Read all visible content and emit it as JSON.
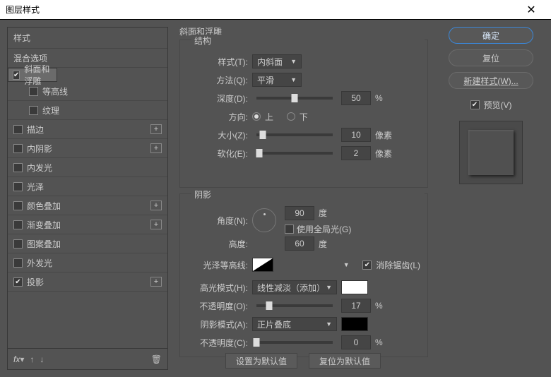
{
  "title": "图层样式",
  "sidebar": {
    "header": "样式",
    "blend": "混合选项",
    "items": [
      {
        "label": "斜面和浮雕",
        "checked": true,
        "selected": true,
        "plus": false
      },
      {
        "label": "等高线",
        "checked": false,
        "indent": true
      },
      {
        "label": "纹理",
        "checked": false,
        "indent": true
      },
      {
        "label": "描边",
        "checked": false,
        "plus": true
      },
      {
        "label": "内阴影",
        "checked": false,
        "plus": true
      },
      {
        "label": "内发光",
        "checked": false
      },
      {
        "label": "光泽",
        "checked": false
      },
      {
        "label": "颜色叠加",
        "checked": false,
        "plus": true
      },
      {
        "label": "渐变叠加",
        "checked": false,
        "plus": true
      },
      {
        "label": "图案叠加",
        "checked": false
      },
      {
        "label": "外发光",
        "checked": false
      },
      {
        "label": "投影",
        "checked": true,
        "plus": true
      }
    ],
    "foot_fx": "fx"
  },
  "buttons": {
    "ok": "确定",
    "reset": "复位",
    "newstyle": "新建样式(W)...",
    "preview": "预览(V)"
  },
  "center": {
    "title": "斜面和浮雕",
    "structure": {
      "legend": "结构",
      "style_label": "样式(T):",
      "style_value": "内斜面",
      "method_label": "方法(Q):",
      "method_value": "平滑",
      "depth_label": "深度(D):",
      "depth_value": "50",
      "depth_unit": "%",
      "direction_label": "方向:",
      "up": "上",
      "down": "下",
      "size_label": "大小(Z):",
      "size_value": "10",
      "size_unit": "像素",
      "soften_label": "软化(E):",
      "soften_value": "2",
      "soften_unit": "像素"
    },
    "shading": {
      "legend": "阴影",
      "angle_label": "角度(N):",
      "angle_value": "90",
      "angle_unit": "度",
      "global_label": "使用全局光(G)",
      "alt_label": "高度:",
      "alt_value": "60",
      "alt_unit": "度",
      "gloss_label": "光泽等高线:",
      "antialias": "消除锯齿(L)",
      "hmode_label": "高光模式(H):",
      "hmode_value": "线性减淡（添加）",
      "hcolor": "#ffffff",
      "hopacity_label": "不透明度(O):",
      "hopacity_value": "17",
      "smode_label": "阴影模式(A):",
      "smode_value": "正片叠底",
      "scolor": "#000000",
      "sopacity_label": "不透明度(C):",
      "sopacity_value": "0",
      "percent": "%"
    },
    "footer": {
      "default": "设置为默认值",
      "reset": "复位为默认值"
    }
  }
}
